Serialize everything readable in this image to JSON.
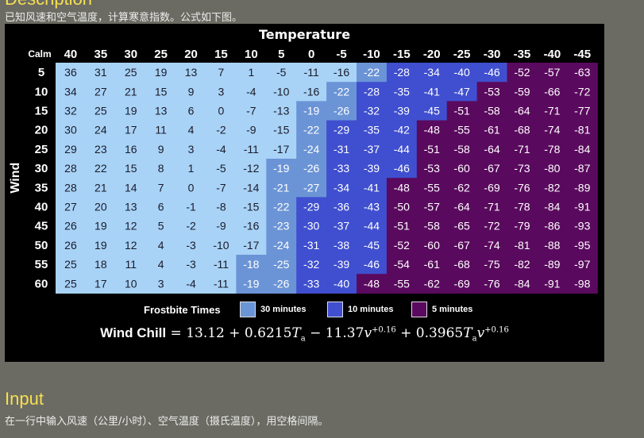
{
  "page": {
    "description_heading": "Description",
    "description_text": "已知风速和空气温度，计算寒意指数。公式如下图。",
    "input_heading": "Input",
    "input_text": "在一行中输入风速（公里/小时）、空气温度（摄氏温度），用空格间隔。"
  },
  "figure": {
    "title": "Temperature",
    "y_label": "Wind",
    "corner_label": "Calm",
    "temperatures": [
      "40",
      "35",
      "30",
      "25",
      "20",
      "15",
      "10",
      "5",
      "0",
      "-5",
      "-10",
      "-15",
      "-20",
      "-25",
      "-30",
      "-35",
      "-40",
      "-45"
    ],
    "winds": [
      "5",
      "10",
      "15",
      "20",
      "25",
      "30",
      "35",
      "40",
      "45",
      "50",
      "55",
      "60"
    ],
    "rows": [
      [
        "36",
        "31",
        "25",
        "19",
        "13",
        "7",
        "1",
        "-5",
        "-11",
        "-16",
        "-22",
        "-28",
        "-34",
        "-40",
        "-46",
        "-52",
        "-57",
        "-63"
      ],
      [
        "34",
        "27",
        "21",
        "15",
        "9",
        "3",
        "-4",
        "-10",
        "-16",
        "-22",
        "-28",
        "-35",
        "-41",
        "-47",
        "-53",
        "-59",
        "-66",
        "-72"
      ],
      [
        "32",
        "25",
        "19",
        "13",
        "6",
        "0",
        "-7",
        "-13",
        "-19",
        "-26",
        "-32",
        "-39",
        "-45",
        "-51",
        "-58",
        "-64",
        "-71",
        "-77"
      ],
      [
        "30",
        "24",
        "17",
        "11",
        "4",
        "-2",
        "-9",
        "-15",
        "-22",
        "-29",
        "-35",
        "-42",
        "-48",
        "-55",
        "-61",
        "-68",
        "-74",
        "-81"
      ],
      [
        "29",
        "23",
        "16",
        "9",
        "3",
        "-4",
        "-11",
        "-17",
        "-24",
        "-31",
        "-37",
        "-44",
        "-51",
        "-58",
        "-64",
        "-71",
        "-78",
        "-84"
      ],
      [
        "28",
        "22",
        "15",
        "8",
        "1",
        "-5",
        "-12",
        "-19",
        "-26",
        "-33",
        "-39",
        "-46",
        "-53",
        "-60",
        "-67",
        "-73",
        "-80",
        "-87"
      ],
      [
        "28",
        "21",
        "14",
        "7",
        "0",
        "-7",
        "-14",
        "-21",
        "-27",
        "-34",
        "-41",
        "-48",
        "-55",
        "-62",
        "-69",
        "-76",
        "-82",
        "-89"
      ],
      [
        "27",
        "20",
        "13",
        "6",
        "-1",
        "-8",
        "-15",
        "-22",
        "-29",
        "-36",
        "-43",
        "-50",
        "-57",
        "-64",
        "-71",
        "-78",
        "-84",
        "-91"
      ],
      [
        "26",
        "19",
        "12",
        "5",
        "-2",
        "-9",
        "-16",
        "-23",
        "-30",
        "-37",
        "-44",
        "-51",
        "-58",
        "-65",
        "-72",
        "-79",
        "-86",
        "-93"
      ],
      [
        "26",
        "19",
        "12",
        "4",
        "-3",
        "-10",
        "-17",
        "-24",
        "-31",
        "-38",
        "-45",
        "-52",
        "-60",
        "-67",
        "-74",
        "-81",
        "-88",
        "-95"
      ],
      [
        "25",
        "18",
        "11",
        "4",
        "-3",
        "-11",
        "-18",
        "-25",
        "-32",
        "-39",
        "-46",
        "-54",
        "-61",
        "-68",
        "-75",
        "-82",
        "-89",
        "-97"
      ],
      [
        "25",
        "17",
        "10",
        "3",
        "-4",
        "-11",
        "-19",
        "-26",
        "-33",
        "-40",
        "-48",
        "-55",
        "-62",
        "-69",
        "-76",
        "-84",
        "-91",
        "-98"
      ]
    ],
    "legend": {
      "label": "Frostbite Times",
      "items": [
        {
          "text": "30 minutes",
          "color": "#6b94d6"
        },
        {
          "text": "10 minutes",
          "color": "#3f4fcf"
        },
        {
          "text": "5 minutes",
          "color": "#5a0a5e"
        }
      ]
    },
    "formula": {
      "lhs": "Wind Chill",
      "eq": " = ",
      "c0": "13.12 + 0.6215",
      "c1": " − 11.37",
      "c2": " + 0.3965",
      "ta_var": "T",
      "ta_sub": "a",
      "v_var": "v",
      "exp": "+0.16"
    },
    "colors": {
      "safe": "#a8d3f7",
      "min30": "#6b94d6",
      "min10": "#3f4fcf",
      "min5": "#5a0a5e"
    }
  }
}
